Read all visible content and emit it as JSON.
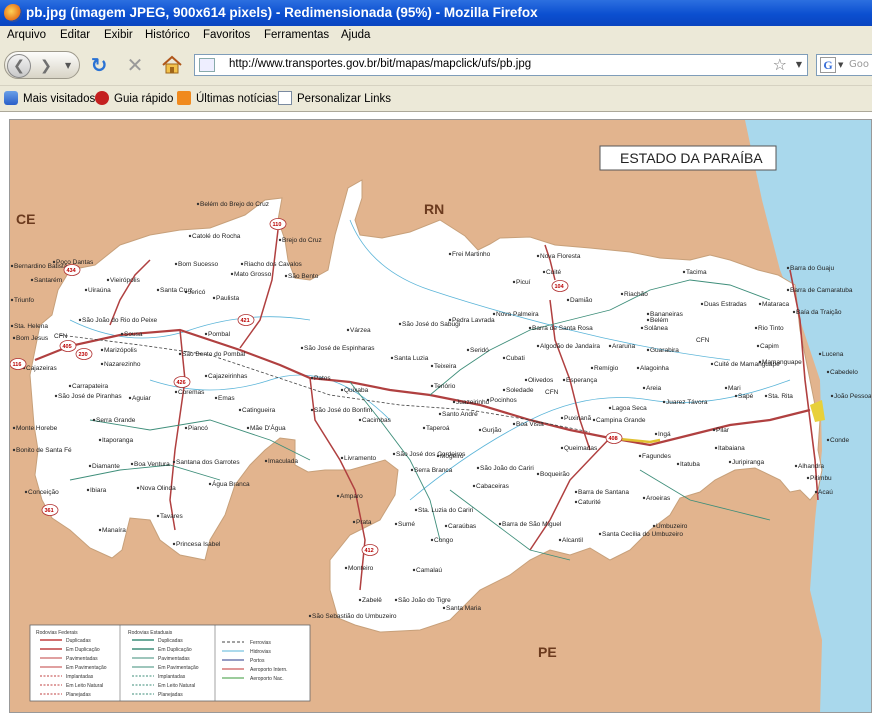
{
  "window": {
    "title": "pb.jpg (imagem JPEG, 900x614 pixels) - Redimensionada (95%) - Mozilla Firefox"
  },
  "menu": {
    "items": [
      "Arquivo",
      "Editar",
      "Exibir",
      "Histórico",
      "Favoritos",
      "Ferramentas",
      "Ajuda"
    ]
  },
  "nav": {
    "url": "http://www.transportes.gov.br/bit/mapas/mapclick/ufs/pb.jpg",
    "search_placeholder": "Goo"
  },
  "bookmarks": [
    "Mais visitados",
    "Guia rápido",
    "Últimas notícias",
    "Personalizar Links"
  ],
  "map": {
    "title": "ESTADO DA PARAÍBA",
    "neighbors": [
      "CE",
      "RN",
      "PE"
    ],
    "cities": [
      "Belém do Brejo do Cruz",
      "Catolé do Rocha",
      "Brejo do Cruz",
      "Riacho dos Cavalos",
      "Bom Sucesso",
      "Mato Grosso",
      "São Bento",
      "Paulista",
      "Jericó",
      "Santa Cruz",
      "Bernardino Batista",
      "Poço Dantas",
      "Santarém",
      "Uiraúna",
      "Vieirópolis",
      "Triunfo",
      "São João do Rio do Peixe",
      "Sousa",
      "Pombal",
      "Sta. Helena",
      "Bom Jesus",
      "Cajazeiras",
      "Marizópolis",
      "Nazarezinho",
      "São Bento do Pombal",
      "Cajazeirinhas",
      "Carrapateira",
      "São José de Piranhas",
      "Aguiar",
      "Coremas",
      "Emas",
      "Catingueira",
      "Serra Grande",
      "Itaporanga",
      "Piancó",
      "Mãe D'Água",
      "Monte Horebe",
      "Bonito de Santa Fé",
      "Diamante",
      "Boa Ventura",
      "Santana dos Garrotes",
      "Água Branca",
      "Imaculada",
      "Conceição",
      "Ibiara",
      "Nova Olinda",
      "Tavares",
      "Manaíra",
      "Princesa Isabel",
      "Patos",
      "Quixaba",
      "São José do Bonfim",
      "Cacimbas",
      "Livramento",
      "Várzea",
      "São José de Espinharas",
      "São José do Sabugi",
      "Santa Luzia",
      "Teixeira",
      "Frei Martinho",
      "Nova Floresta",
      "Cuité",
      "Picuí",
      "Pedra Lavrada",
      "Nova Palmeira",
      "Barra de Santa Rosa",
      "Damião",
      "Algodão de Jandaíra",
      "Seridó",
      "Cubati",
      "Tenório",
      "Olivedos",
      "Soledade",
      "Esperança",
      "Remígio",
      "Pocinhos",
      "Juazeirinho",
      "Santo André",
      "Taperoá",
      "Gurjão",
      "Boa Vista",
      "Puxinanã",
      "Campina Grande",
      "Queimadas",
      "Lagoa Seca",
      "Areia",
      "Alagoinha",
      "Guarabira",
      "Araruna",
      "Tacima",
      "Riachão",
      "Bananeiras",
      "Belém",
      "Solânea",
      "Duas Estradas",
      "Mataraca",
      "Barra do Guaju",
      "Barra de Camaratuba",
      "Rio Tinto",
      "Baía da Traição",
      "Capim",
      "Mamanguape",
      "Cuité de Mamanguape",
      "Mari",
      "Sapé",
      "Sta. Rita",
      "Lucena",
      "Cabedelo",
      "João Pessoa",
      "Conde",
      "Alhandra",
      "Pitimbu",
      "Acaú",
      "Pilar",
      "Itabaiana",
      "Juarez Távora",
      "Ingá",
      "Fagundes",
      "Itatuba",
      "Juripiranga",
      "Aroeiras",
      "Umbuzeiro",
      "Santa Cecília do Umbuzeiro",
      "Alcantil",
      "Barra de Santana",
      "Caturité",
      "Boqueirão",
      "Cabaceiras",
      "Barra de São Miguel",
      "São João do Cariri",
      "São José dos Cordeiros",
      "Serra Branca",
      "Sumé",
      "Caraúbas",
      "Congo",
      "Sta. Luzia do Cariri",
      "Amparo",
      "Prata",
      "Monteiro",
      "Camalaú",
      "Zabelê",
      "São João do Tigre",
      "São Sebastião do Umbuzeiro",
      "Santa Maria",
      "Mogeiro"
    ],
    "highways": [
      "110",
      "434",
      "405",
      "230",
      "116",
      "361",
      "426",
      "421",
      "104",
      "408",
      "412"
    ],
    "legend": {
      "federal_title": "Rodovias Federais",
      "state_title": "Rodovias Estaduais",
      "federal_items": [
        "Duplicadas",
        "Em Duplicação",
        "Pavimentadas",
        "Em Pavimentação",
        "Implantadas",
        "Em Leito Natural",
        "Planejadas"
      ],
      "state_items": [
        "Duplicadas",
        "Em Duplicação",
        "Pavimentadas",
        "Em Pavimentação",
        "Implantadas",
        "Em Leito Natural",
        "Planejadas"
      ],
      "other_items": [
        "Ferrovias",
        "Hidrovias",
        "Portos",
        "Aeroporto Intern.",
        "Aeroporto Nac."
      ]
    },
    "labels": {
      "cfn": "CFN"
    }
  }
}
